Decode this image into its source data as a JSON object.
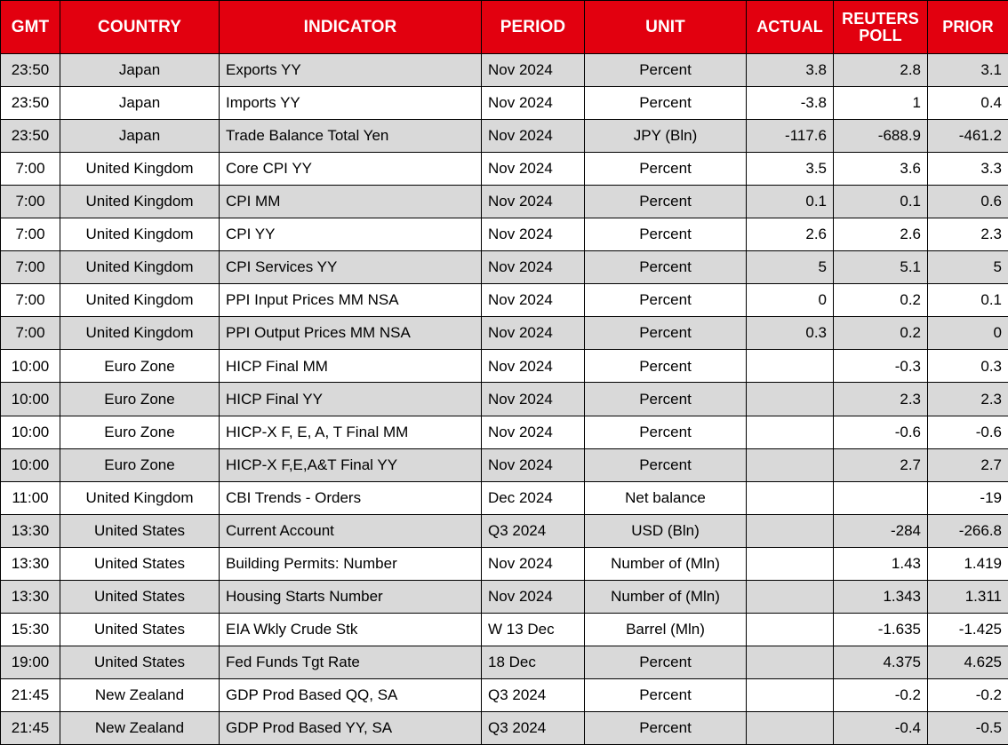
{
  "table": {
    "columns": [
      {
        "key": "gmt",
        "label": "GMT"
      },
      {
        "key": "country",
        "label": "COUNTRY"
      },
      {
        "key": "indicator",
        "label": "INDICATOR"
      },
      {
        "key": "period",
        "label": "PERIOD"
      },
      {
        "key": "unit",
        "label": "UNIT"
      },
      {
        "key": "actual",
        "label": "ACTUAL"
      },
      {
        "key": "poll",
        "label": "REUTERS\nPOLL"
      },
      {
        "key": "prior",
        "label": "PRIOR"
      }
    ],
    "header": {
      "gmt": "GMT",
      "country": "COUNTRY",
      "indicator": "INDICATOR",
      "period": "PERIOD",
      "unit": "UNIT",
      "actual": "ACTUAL",
      "poll_line1": "REUTERS",
      "poll_line2": "POLL",
      "prior": "PRIOR"
    },
    "colors": {
      "header_background": "#E2000F",
      "header_text": "#FFFFFF",
      "row_shaded": "#D9D9D9",
      "row_plain": "#FFFFFF",
      "grid_line": "#000000",
      "body_text": "#000000"
    },
    "rows": [
      {
        "gmt": "23:50",
        "country": "Japan",
        "indicator": "Exports YY",
        "period": "Nov 2024",
        "unit": "Percent",
        "actual": "3.8",
        "poll": "2.8",
        "prior": "3.1"
      },
      {
        "gmt": "23:50",
        "country": "Japan",
        "indicator": "Imports YY",
        "period": "Nov 2024",
        "unit": "Percent",
        "actual": "-3.8",
        "poll": "1",
        "prior": "0.4"
      },
      {
        "gmt": "23:50",
        "country": "Japan",
        "indicator": "Trade Balance Total Yen",
        "period": "Nov 2024",
        "unit": "JPY (Bln)",
        "actual": "-117.6",
        "poll": "-688.9",
        "prior": "-461.2"
      },
      {
        "gmt": "7:00",
        "country": "United Kingdom",
        "indicator": "Core CPI YY",
        "period": "Nov 2024",
        "unit": "Percent",
        "actual": "3.5",
        "poll": "3.6",
        "prior": "3.3"
      },
      {
        "gmt": "7:00",
        "country": "United Kingdom",
        "indicator": "CPI MM",
        "period": "Nov 2024",
        "unit": "Percent",
        "actual": "0.1",
        "poll": "0.1",
        "prior": "0.6"
      },
      {
        "gmt": "7:00",
        "country": "United Kingdom",
        "indicator": "CPI YY",
        "period": "Nov 2024",
        "unit": "Percent",
        "actual": "2.6",
        "poll": "2.6",
        "prior": "2.3"
      },
      {
        "gmt": "7:00",
        "country": "United Kingdom",
        "indicator": "CPI Services YY",
        "period": "Nov 2024",
        "unit": "Percent",
        "actual": "5",
        "poll": "5.1",
        "prior": "5"
      },
      {
        "gmt": "7:00",
        "country": "United Kingdom",
        "indicator": "PPI Input Prices MM NSA",
        "period": "Nov 2024",
        "unit": "Percent",
        "actual": "0",
        "poll": "0.2",
        "prior": "0.1"
      },
      {
        "gmt": "7:00",
        "country": "United Kingdom",
        "indicator": "PPI Output Prices MM NSA",
        "period": "Nov 2024",
        "unit": "Percent",
        "actual": "0.3",
        "poll": "0.2",
        "prior": "0"
      },
      {
        "gmt": "10:00",
        "country": "Euro Zone",
        "indicator": "HICP Final MM",
        "period": "Nov 2024",
        "unit": "Percent",
        "actual": "",
        "poll": "-0.3",
        "prior": "0.3"
      },
      {
        "gmt": "10:00",
        "country": "Euro Zone",
        "indicator": "HICP Final YY",
        "period": "Nov 2024",
        "unit": "Percent",
        "actual": "",
        "poll": "2.3",
        "prior": "2.3"
      },
      {
        "gmt": "10:00",
        "country": "Euro Zone",
        "indicator": "HICP-X F, E, A, T Final MM",
        "period": "Nov 2024",
        "unit": "Percent",
        "actual": "",
        "poll": "-0.6",
        "prior": "-0.6"
      },
      {
        "gmt": "10:00",
        "country": "Euro Zone",
        "indicator": "HICP-X F,E,A&T Final YY",
        "period": "Nov 2024",
        "unit": "Percent",
        "actual": "",
        "poll": "2.7",
        "prior": "2.7"
      },
      {
        "gmt": "11:00",
        "country": "United Kingdom",
        "indicator": "CBI Trends - Orders",
        "period": "Dec 2024",
        "unit": "Net balance",
        "actual": "",
        "poll": "",
        "prior": "-19"
      },
      {
        "gmt": "13:30",
        "country": "United States",
        "indicator": "Current Account",
        "period": "Q3 2024",
        "unit": "USD (Bln)",
        "actual": "",
        "poll": "-284",
        "prior": "-266.8"
      },
      {
        "gmt": "13:30",
        "country": "United States",
        "indicator": "Building Permits: Number",
        "period": "Nov 2024",
        "unit": "Number of (Mln)",
        "actual": "",
        "poll": "1.43",
        "prior": "1.419"
      },
      {
        "gmt": "13:30",
        "country": "United States",
        "indicator": "Housing Starts Number",
        "period": "Nov 2024",
        "unit": "Number of (Mln)",
        "actual": "",
        "poll": "1.343",
        "prior": "1.311"
      },
      {
        "gmt": "15:30",
        "country": "United States",
        "indicator": "EIA Wkly Crude Stk",
        "period": "W 13 Dec",
        "unit": "Barrel (Mln)",
        "actual": "",
        "poll": "-1.635",
        "prior": "-1.425"
      },
      {
        "gmt": "19:00",
        "country": "United States",
        "indicator": "Fed Funds Tgt Rate",
        "period": "18 Dec",
        "unit": "Percent",
        "actual": "",
        "poll": "4.375",
        "prior": "4.625"
      },
      {
        "gmt": "21:45",
        "country": "New Zealand",
        "indicator": "GDP Prod Based QQ, SA",
        "period": "Q3 2024",
        "unit": "Percent",
        "actual": "",
        "poll": "-0.2",
        "prior": "-0.2"
      },
      {
        "gmt": "21:45",
        "country": "New Zealand",
        "indicator": "GDP Prod Based YY, SA",
        "period": "Q3 2024",
        "unit": "Percent",
        "actual": "",
        "poll": "-0.4",
        "prior": "-0.5"
      }
    ]
  }
}
